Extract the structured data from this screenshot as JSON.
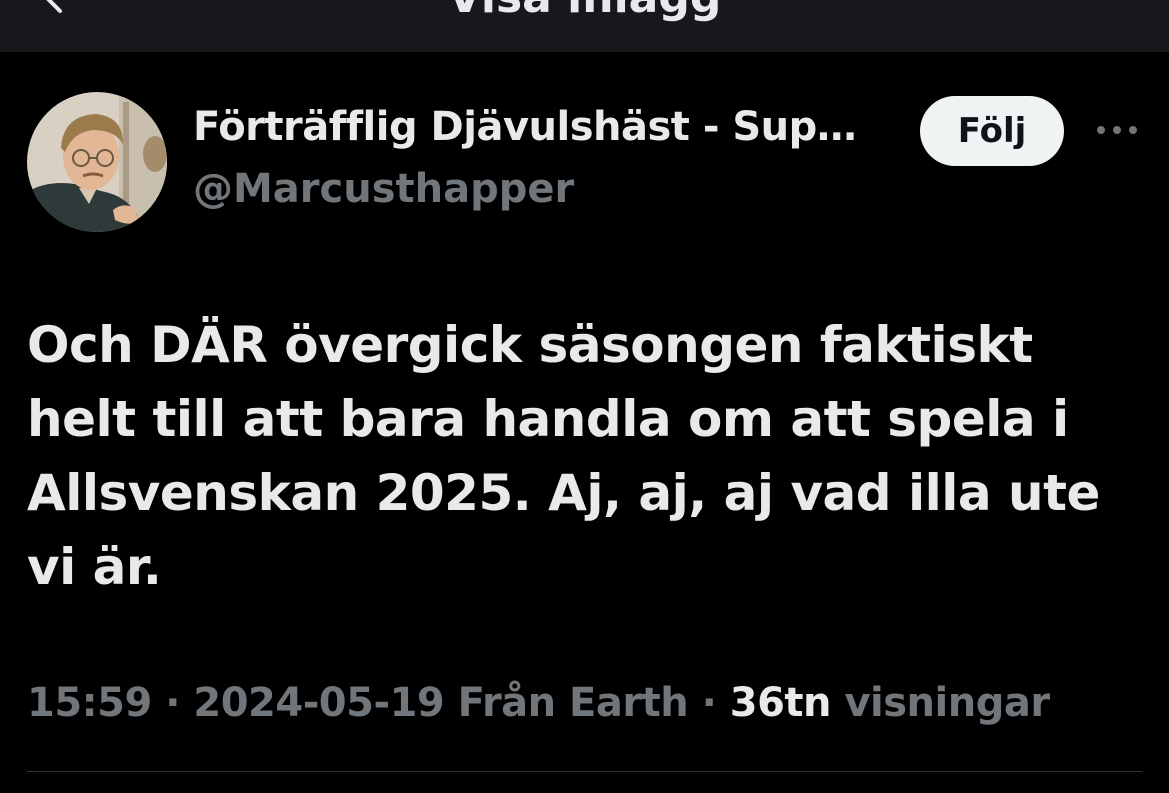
{
  "topbar": {
    "title": "Visa inlägg",
    "back_icon": "chevron-left-icon"
  },
  "author": {
    "display_name": "Förträfflig Djävulshäst - Sup…",
    "handle": "@Marcusthapper",
    "avatar_icon": "avatar"
  },
  "follow_button": {
    "label": "Följ"
  },
  "more_icon": "more-horizontal-icon",
  "tweet": {
    "text": "Och DÄR övergick säsongen faktiskt helt till att bara handla om att spela i Allsvenskan 2025. Aj, aj, aj vad illa ute vi är."
  },
  "meta": {
    "time": "15:59",
    "separator": " · ",
    "date": "2024-05-19",
    "source": "Från Earth",
    "views_count": "36tn",
    "views_label": "visningar"
  },
  "colors": {
    "background": "#000000",
    "topbar_background": "#16181c",
    "text_primary": "#e7e9ea",
    "text_secondary": "#71767b",
    "button_background": "#eff3f4",
    "divider": "#2f3336"
  }
}
